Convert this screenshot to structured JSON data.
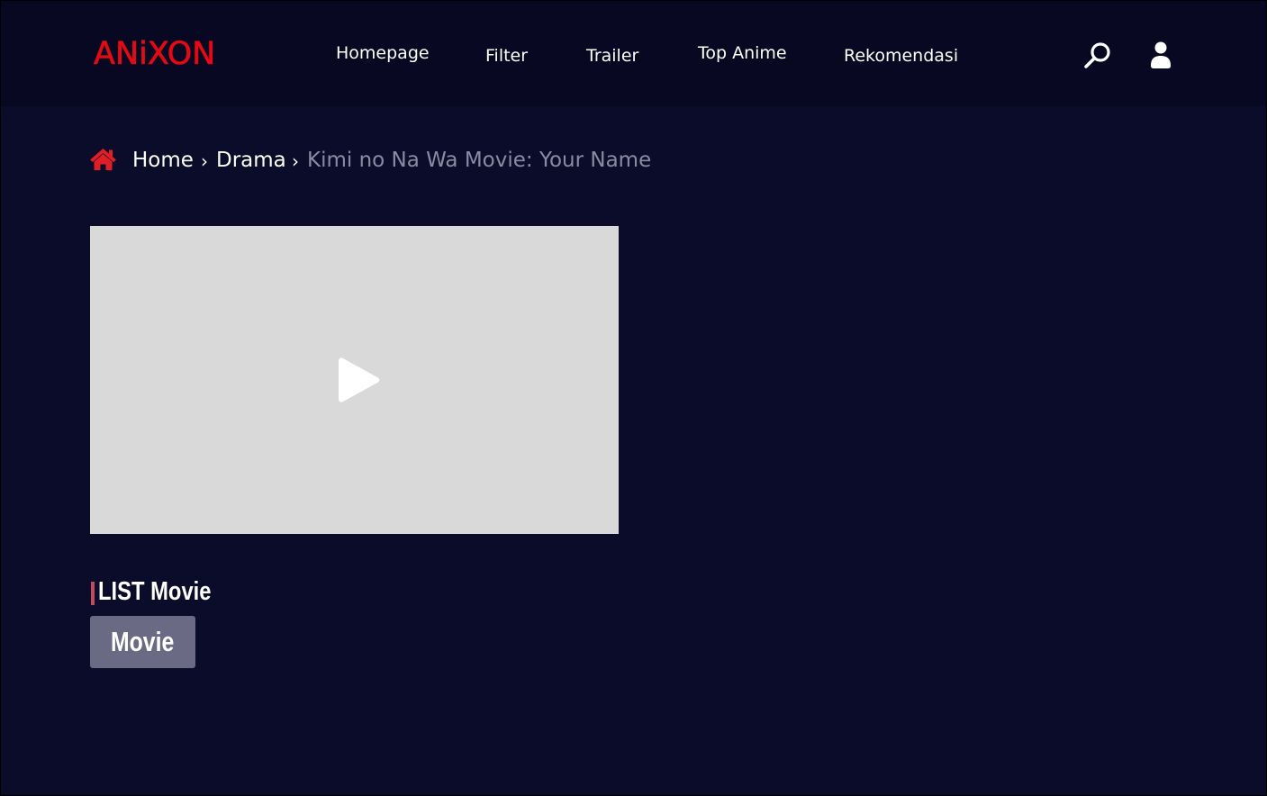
{
  "header": {
    "logo": "ANiXON",
    "nav": [
      {
        "label": "Homepage"
      },
      {
        "label": "Filter"
      },
      {
        "label": "Trailer"
      },
      {
        "label": "Top Anime"
      },
      {
        "label": "Rekomendasi"
      }
    ],
    "icons": {
      "search": "search-icon",
      "user": "user-icon"
    }
  },
  "breadcrumb": {
    "home_icon": "home-icon",
    "items": [
      {
        "label": "Home"
      },
      {
        "label": "Drama"
      },
      {
        "label": "Kimi no Na Wa Movie: Your Name"
      }
    ],
    "separator": "›"
  },
  "player": {
    "icon": "play-icon"
  },
  "list_section": {
    "title": "LIST Movie",
    "tags": [
      {
        "label": "Movie"
      }
    ]
  },
  "colors": {
    "background": "#0b0c29",
    "header_background": "#080822",
    "brand": "#e50914",
    "breadcrumb_current": "#8a8ba3",
    "player_placeholder": "#d9d9d9",
    "title_accent": "#c44a62",
    "tag_background": "#6b6a84"
  }
}
